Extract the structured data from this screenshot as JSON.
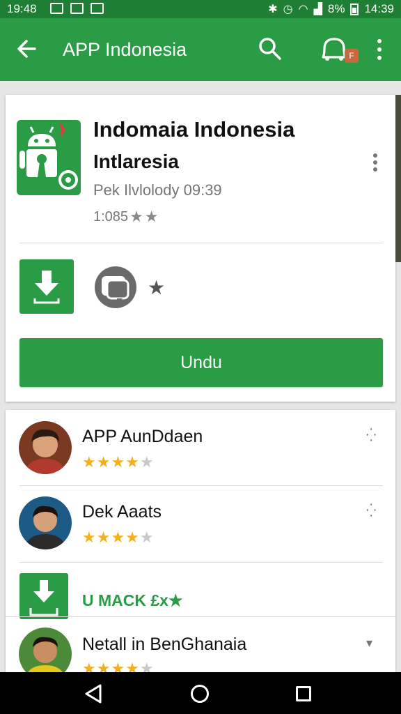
{
  "status_bar": {
    "time_left": "19:48",
    "battery": "8%",
    "time_right": "14:39"
  },
  "app_bar": {
    "title": "APP Indonesia",
    "badge": "F",
    "icons": [
      "back-arrow-icon",
      "search-icon",
      "notification-bell-icon",
      "more-vert-icon"
    ]
  },
  "app_card": {
    "name": "Indomaia Indonesia",
    "developer": "Intlaresia",
    "meta": "Pek Ilvlolody 09:39",
    "rating_text": "1:085",
    "install_label": "Undu",
    "icons": [
      "android-app-icon",
      "download-icon",
      "chat-bubble-icon",
      "star-icon"
    ]
  },
  "reviews": [
    {
      "name": "APP AunDdaen",
      "stars": 4,
      "max": 5
    },
    {
      "name": "Dek Aaats",
      "stars": 4,
      "max": 5
    },
    {
      "promo": "U MACK £x★"
    },
    {
      "name": "Netall in BenGhanaia",
      "stars": 4,
      "max": 5
    }
  ],
  "colors": {
    "status_bar": "#1e7e34",
    "app_bar": "#2a9c46",
    "accent": "#2a9c46",
    "star": "#f2b01e"
  }
}
